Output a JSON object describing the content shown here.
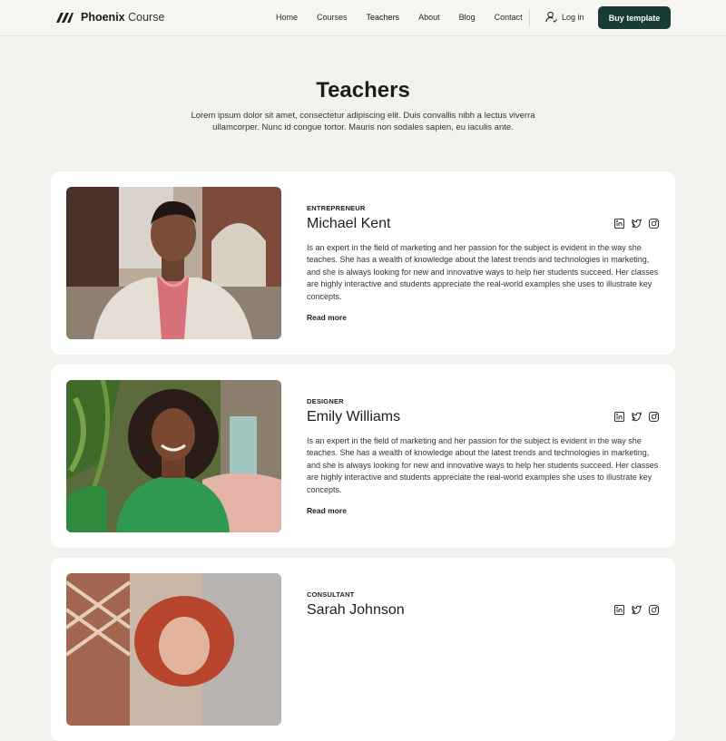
{
  "header": {
    "logo_bold": "Phoenix",
    "logo_light": " Course",
    "nav": [
      {
        "label": "Home"
      },
      {
        "label": "Courses"
      },
      {
        "label": "Teachers"
      },
      {
        "label": "About"
      },
      {
        "label": "Blog"
      },
      {
        "label": "Contact"
      }
    ],
    "login_label": "Log in",
    "buy_label": "Buy template"
  },
  "hero": {
    "title": "Teachers",
    "intro": "Lorem ipsum dolor sit amet, consectetur adipiscing elit. Duis convallis nibh a lectus viverra ullamcorper. Nunc id congue tortor. Mauris non sodales sapien, eu iaculis ante."
  },
  "teachers": [
    {
      "role": "ENTREPRENEUR",
      "name": "Michael Kent",
      "bio": "Is an expert in the field of marketing and her passion for the subject is evident in the way she teaches. She has a wealth of knowledge about the latest trends and technologies in marketing, and she is always looking for new and innovative ways to help her students succeed. Her classes are highly interactive and students appreciate the real-world examples she uses to illustrate key concepts.",
      "read_more": "Read more"
    },
    {
      "role": "DESIGNER",
      "name": "Emily Williams",
      "bio": "Is an expert in the field of marketing and her passion for the subject is evident in the way she teaches. She has a wealth of knowledge about the latest trends and technologies in marketing, and she is always looking for new and innovative ways to help her students succeed. Her classes are highly interactive and students appreciate the real-world examples she uses to illustrate key concepts.",
      "read_more": "Read more"
    },
    {
      "role": "CONSULTANT",
      "name": "Sarah Johnson"
    }
  ],
  "icons": {
    "logo": "phoenix-logo-icon",
    "login": "user-icon",
    "social": [
      "linkedin-icon",
      "twitter-icon",
      "instagram-icon"
    ]
  },
  "colors": {
    "background": "#f3f2ee",
    "card": "#ffffff",
    "button": "#183b35",
    "text": "#1c1e1c"
  }
}
